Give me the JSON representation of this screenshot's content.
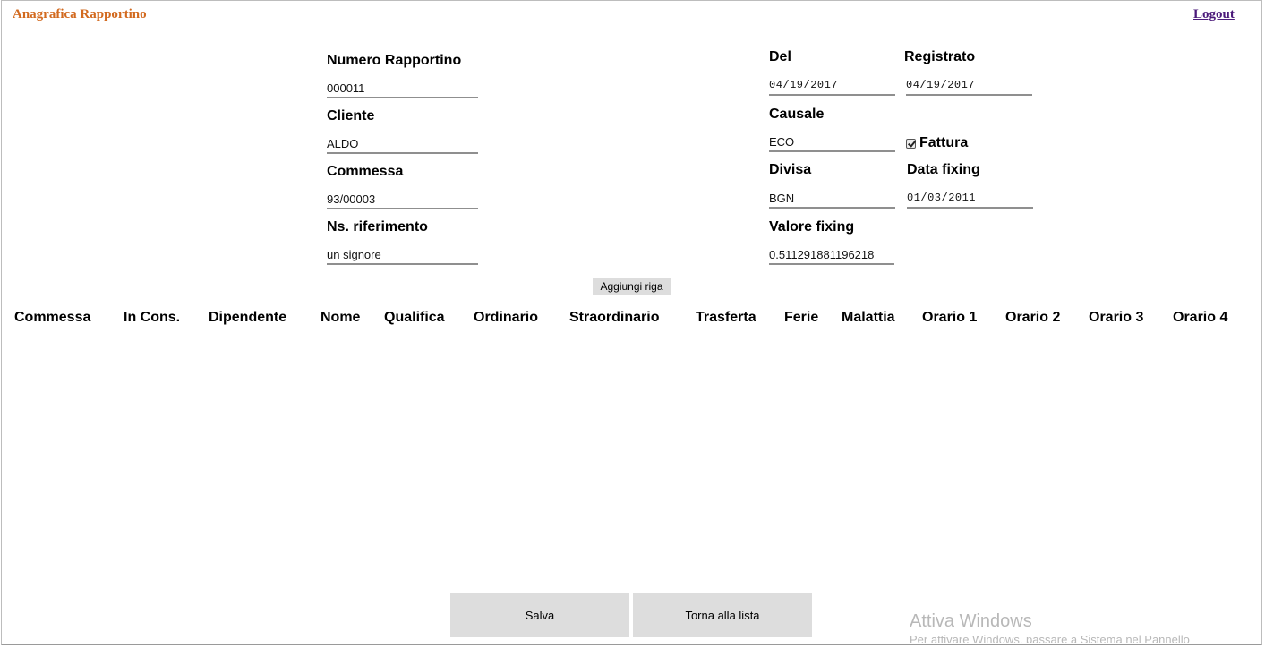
{
  "header": {
    "app_title": "Anagrafica Rapportino",
    "logout": "Logout"
  },
  "form": {
    "numero_rapportino": {
      "label": "Numero Rapportino",
      "value": "000011"
    },
    "cliente": {
      "label": "Cliente",
      "value": "ALDO"
    },
    "commessa": {
      "label": "Commessa",
      "value": "93/00003"
    },
    "ns_riferimento": {
      "label": "Ns. riferimento",
      "value": "un signore"
    },
    "del": {
      "label": "Del",
      "value": "04/19/2017"
    },
    "registrato": {
      "label": "Registrato",
      "value": "04/19/2017"
    },
    "causale": {
      "label": "Causale",
      "value": "ECO"
    },
    "fattura": {
      "label": "Fattura",
      "checked": true
    },
    "divisa": {
      "label": "Divisa",
      "value": "BGN"
    },
    "data_fixing": {
      "label": "Data fixing",
      "value": "01/03/2011"
    },
    "valore_fixing": {
      "label": "Valore fixing",
      "value": "0.511291881196218"
    }
  },
  "add_row_button": "Aggiungi riga",
  "table": {
    "columns": [
      "Commessa",
      "In Cons.",
      "Dipendente",
      "Nome",
      "Qualifica",
      "Ordinario",
      "Straordinario",
      "Trasferta",
      "Ferie",
      "Malattia",
      "Orario 1",
      "Orario 2",
      "Orario 3",
      "Orario 4"
    ],
    "rows": []
  },
  "footer": {
    "save": "Salva",
    "back": "Torna alla lista"
  },
  "watermark": {
    "title": "Attiva Windows",
    "subtitle": "Per attivare Windows, passare a Sistema nel Pannello"
  }
}
